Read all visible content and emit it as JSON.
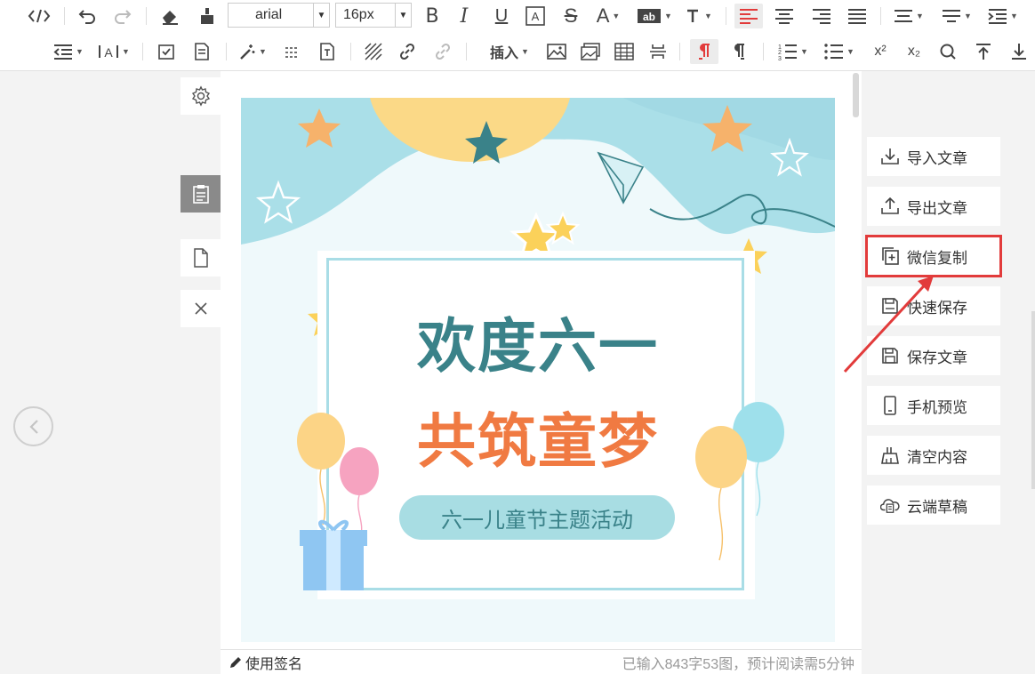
{
  "toolbar": {
    "font_family": "arial",
    "font_size": "16px",
    "insert_label": "插入",
    "superscript": "x²",
    "subscript": "x₂"
  },
  "sidebar_tools": [
    "settings-icon",
    "clipboard-icon",
    "document-icon",
    "close-icon"
  ],
  "poster": {
    "title_line1": "欢度六一",
    "title_line2": "共筑童梦",
    "subtitle": "六一儿童节主题活动",
    "colors": {
      "title1": "#3a8289",
      "title2": "#f07a42",
      "pill": "#a8dde3",
      "bg": "#eff9fb"
    }
  },
  "statusbar": {
    "signature_label": "使用签名",
    "word_count": "已输入843字53图，预计阅读需5分钟"
  },
  "right_panel": {
    "items": [
      {
        "label": "导入文章",
        "icon": "import-icon"
      },
      {
        "label": "导出文章",
        "icon": "export-icon"
      },
      {
        "label": "微信复制",
        "icon": "wechat-copy-icon",
        "highlighted": true
      },
      {
        "label": "快速保存",
        "icon": "quick-save-icon"
      },
      {
        "label": "保存文章",
        "icon": "save-icon"
      },
      {
        "label": "手机预览",
        "icon": "phone-preview-icon"
      },
      {
        "label": "清空内容",
        "icon": "clear-icon"
      },
      {
        "label": "云端草稿",
        "icon": "cloud-draft-icon"
      }
    ],
    "highlight_color": "#e23b3b"
  }
}
